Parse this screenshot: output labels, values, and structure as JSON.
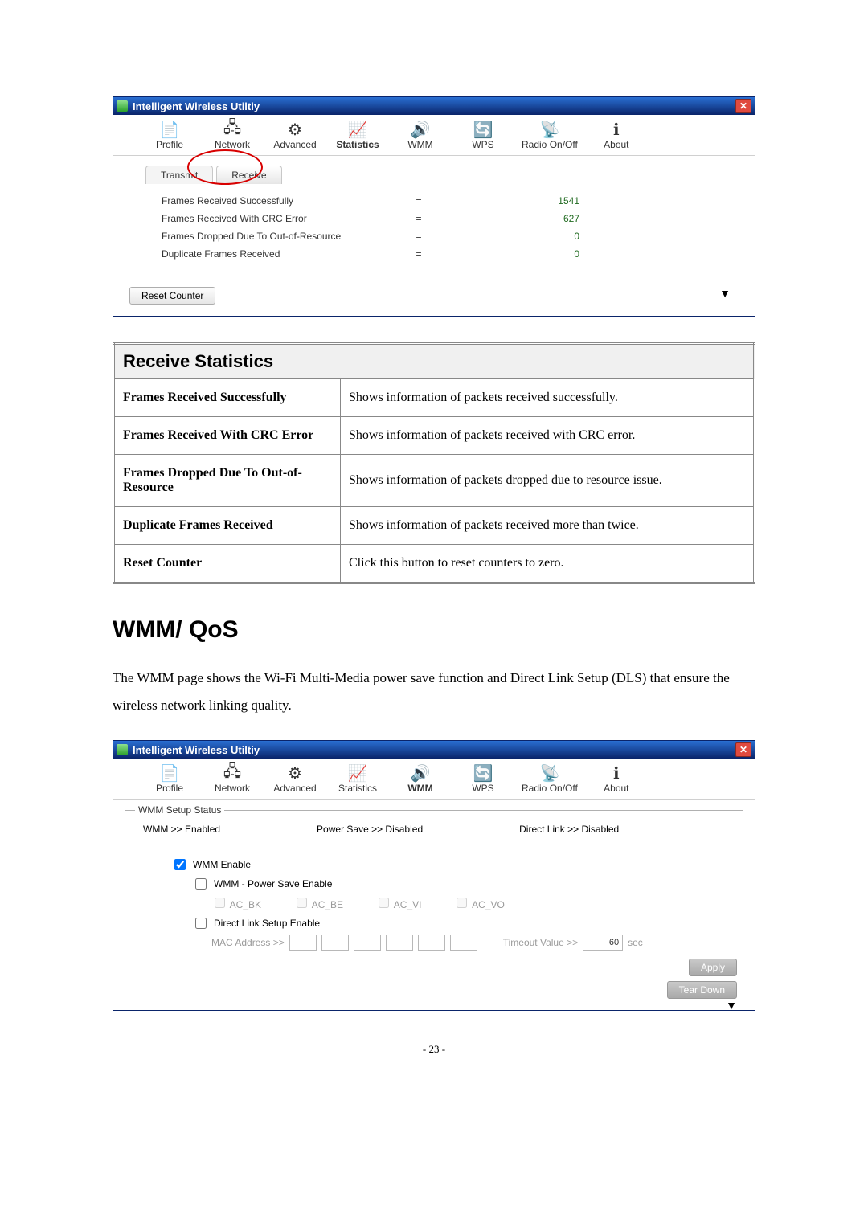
{
  "app_title": "Intelligent Wireless Utiltiy",
  "toolbar": [
    {
      "label": "Profile",
      "icon": "📄"
    },
    {
      "label": "Network",
      "icon": "📶"
    },
    {
      "label": "Advanced",
      "icon": "⚙"
    },
    {
      "label": "Statistics",
      "icon": "📊"
    },
    {
      "label": "WMM",
      "icon": "🔊"
    },
    {
      "label": "WPS",
      "icon": "🔄"
    },
    {
      "label": "Radio On/Off",
      "icon": "📡"
    },
    {
      "label": "About",
      "icon": "ℹ"
    }
  ],
  "subtabs": {
    "transmit": "Transmit",
    "receive": "Receive"
  },
  "stats": [
    {
      "label": "Frames Received Successfully",
      "value": "1541"
    },
    {
      "label": "Frames Received With CRC Error",
      "value": "627"
    },
    {
      "label": "Frames Dropped Due To Out-of-Resource",
      "value": "0"
    },
    {
      "label": "Duplicate Frames Received",
      "value": "0"
    }
  ],
  "reset_label": "Reset Counter",
  "table_heading": "Receive Statistics",
  "rows": [
    {
      "label": "Frames Received Successfully",
      "desc": "Shows information of packets received successfully."
    },
    {
      "label": "Frames Received With CRC Error",
      "desc": "Shows information of packets received with CRC error."
    },
    {
      "label": "Frames Dropped Due To Out-of-Resource",
      "desc": "Shows information of packets dropped due to resource issue."
    },
    {
      "label": "Duplicate Frames Received",
      "desc": "Shows information of packets received more than twice."
    },
    {
      "label": "Reset Counter",
      "desc": "Click this button to reset counters to zero."
    }
  ],
  "section_title": "WMM/ QoS",
  "section_body": "The WMM page shows the Wi-Fi Multi-Media power save function and Direct Link Setup (DLS) that ensure the wireless network linking quality.",
  "wmm": {
    "fieldset_label": "WMM Setup Status",
    "status": {
      "wmm": "WMM >> Enabled",
      "powersave": "Power Save >> Disabled",
      "directlink": "Direct Link >> Disabled"
    },
    "chk_wmm": "WMM Enable",
    "chk_ps": "WMM - Power Save Enable",
    "ac": [
      "AC_BK",
      "AC_BE",
      "AC_VI",
      "AC_VO"
    ],
    "chk_dls": "Direct Link Setup Enable",
    "mac_label": "MAC Address >>",
    "timeout_label": "Timeout Value >>",
    "timeout_value": "60",
    "timeout_unit": "sec",
    "apply": "Apply",
    "teardown": "Tear Down"
  },
  "page_number": "- 23 -"
}
